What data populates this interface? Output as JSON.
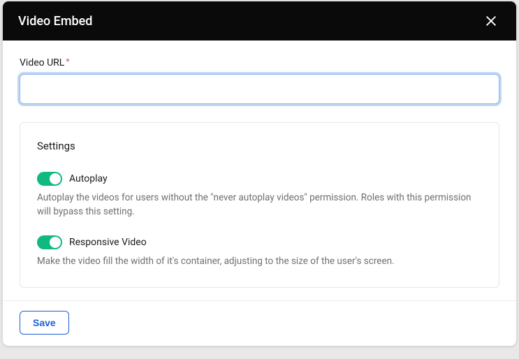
{
  "header": {
    "title": "Video Embed"
  },
  "form": {
    "url_label": "Video URL",
    "required_mark": "*",
    "url_value": ""
  },
  "settings": {
    "title": "Settings",
    "items": [
      {
        "label": "Autoplay",
        "description": "Autoplay the videos for users without the \"never autoplay videos\" permission. Roles with this permission will bypass this setting.",
        "on": true
      },
      {
        "label": "Responsive Video",
        "description": "Make the video fill the width of it's container, adjusting to the size of the user's screen.",
        "on": true
      }
    ]
  },
  "footer": {
    "save_label": "Save"
  }
}
